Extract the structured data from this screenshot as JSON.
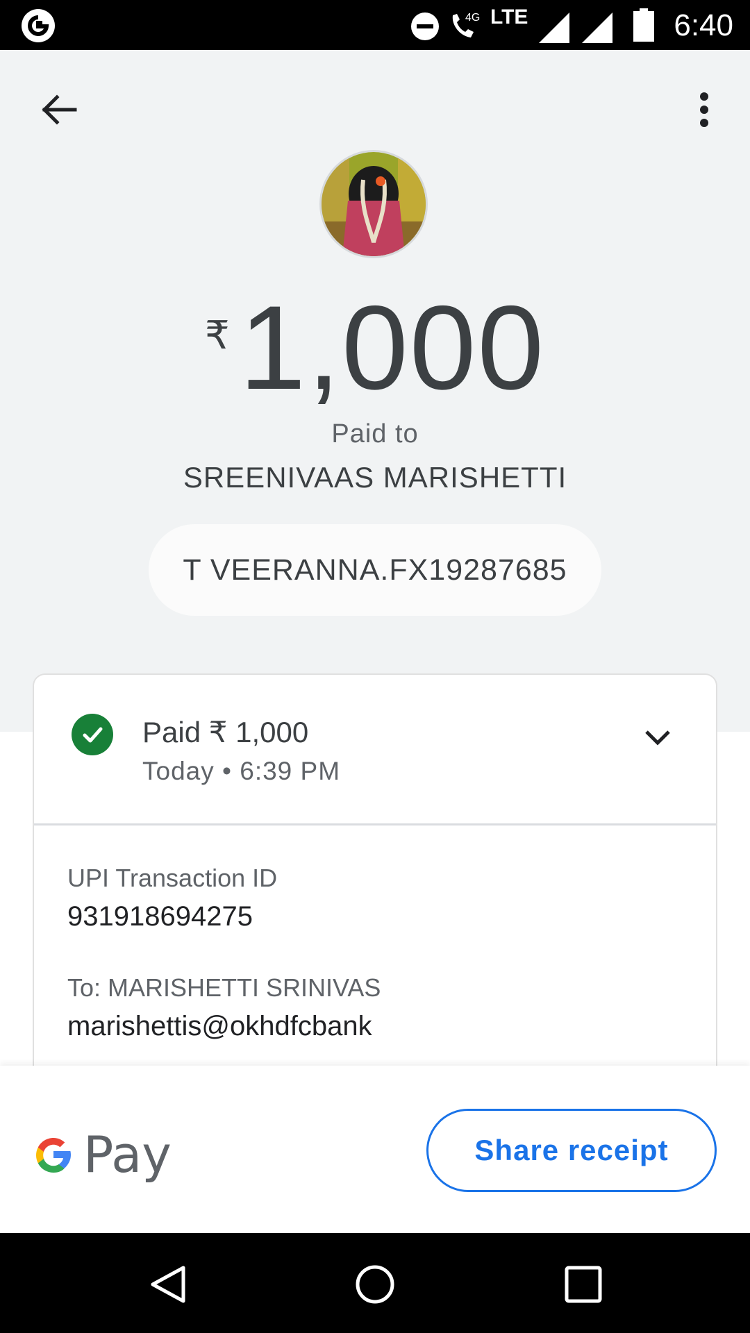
{
  "status_bar": {
    "time": "6:40",
    "network": "4G",
    "network_type": "LTE",
    "icons": [
      "google-icon",
      "do-not-disturb-icon",
      "volte-call-icon",
      "signal-icon",
      "signal-icon",
      "battery-icon"
    ]
  },
  "header": {
    "back_icon": "arrow-back-icon",
    "more_icon": "more-vert-icon"
  },
  "payment": {
    "currency_symbol": "₹",
    "amount": "1,000",
    "paid_to_label": "Paid to",
    "payee_name": "SREENIVAAS MARISHETTI",
    "note": "T VEERANNA.FX19287685"
  },
  "details_card": {
    "status_text": "Paid ₹ 1,000",
    "time_text": "Today • 6:39 PM",
    "upi_label": "UPI Transaction ID",
    "upi_value": "931918694275",
    "to_label": "To: MARISHETTI SRINIVAS",
    "to_value": "marishettis@okhdfcbank"
  },
  "footer": {
    "brand": "Pay",
    "share_label": "Share receipt"
  },
  "colors": {
    "accent": "#1a73e8",
    "success": "#188038",
    "top_bg": "#f1f3f4"
  }
}
